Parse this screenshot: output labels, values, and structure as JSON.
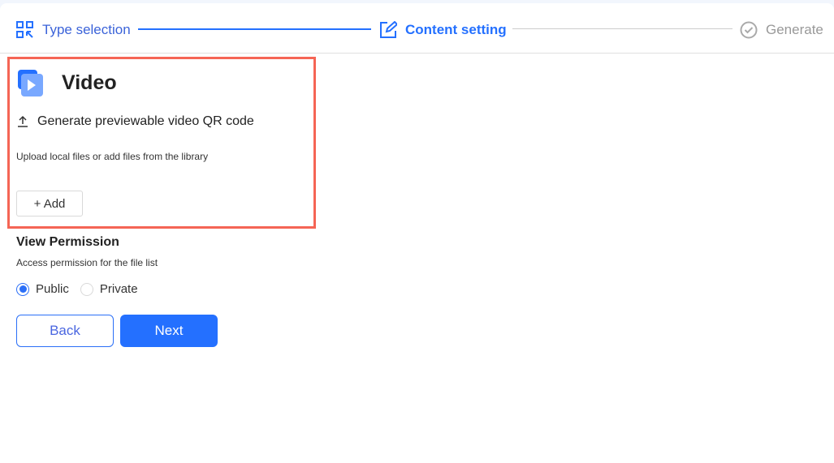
{
  "steps": [
    {
      "label": "Type selection",
      "icon": "qr-select-icon",
      "state": "done"
    },
    {
      "label": "Content setting",
      "icon": "edit-icon",
      "state": "active"
    },
    {
      "label": "Generate",
      "icon": "check-circle-icon",
      "state": "pending"
    }
  ],
  "colors": {
    "accent": "#2470ff",
    "highlight": "#f56555"
  },
  "content": {
    "title": "Video",
    "subtitle": "Generate previewable video QR code",
    "description": "Upload local files or add files from the library",
    "add_label": "Add"
  },
  "permission": {
    "title": "View Permission",
    "description": "Access permission for the file list",
    "options": [
      {
        "label": "Public",
        "selected": true
      },
      {
        "label": "Private",
        "selected": false
      }
    ]
  },
  "actions": {
    "back": "Back",
    "next": "Next"
  }
}
